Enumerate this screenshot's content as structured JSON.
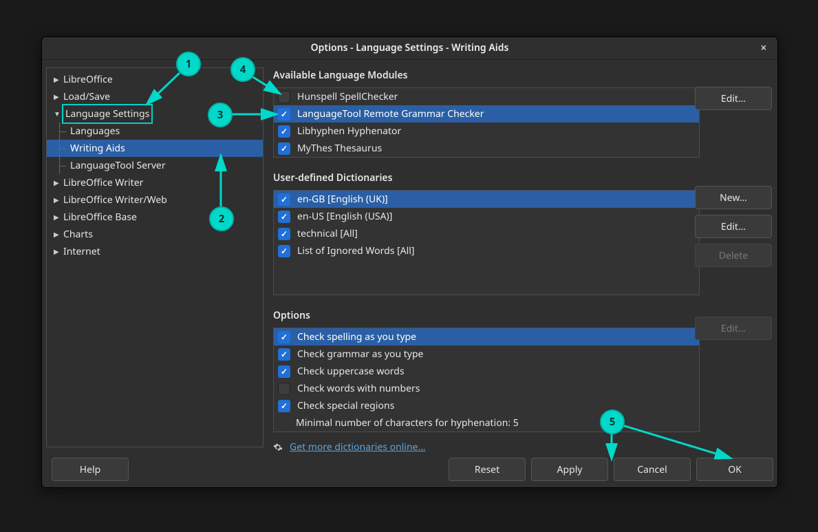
{
  "title": "Options - Language Settings - Writing Aids",
  "tree_top": [
    {
      "label": "LibreOffice",
      "arrow": "▶"
    },
    {
      "label": "Load/Save",
      "arrow": "▶"
    }
  ],
  "tree_lang_label": "Language Settings",
  "tree_lang_children": [
    {
      "label": "Languages"
    },
    {
      "label": "Writing Aids",
      "selected": true
    },
    {
      "label": "LanguageTool Server"
    }
  ],
  "tree_bottom": [
    {
      "label": "LibreOffice Writer",
      "arrow": "▶"
    },
    {
      "label": "LibreOffice Writer/Web",
      "arrow": "▶"
    },
    {
      "label": "LibreOffice Base",
      "arrow": "▶"
    },
    {
      "label": "Charts",
      "arrow": "▶"
    },
    {
      "label": "Internet",
      "arrow": "▶"
    }
  ],
  "section_modules": {
    "title": "Available Language Modules",
    "items": [
      {
        "label": "Hunspell SpellChecker",
        "checked": false
      },
      {
        "label": "LanguageTool Remote Grammar Checker",
        "checked": true,
        "selected": true
      },
      {
        "label": "Libhyphen Hyphenator",
        "checked": true
      },
      {
        "label": "MyThes Thesaurus",
        "checked": true
      }
    ],
    "edit_label": "Edit…"
  },
  "section_dicts": {
    "title": "User-defined Dictionaries",
    "items": [
      {
        "label": "en-GB [English (UK)]",
        "checked": true,
        "selected": true
      },
      {
        "label": "en-US [English (USA)]",
        "checked": true
      },
      {
        "label": "technical [All]",
        "checked": true
      },
      {
        "label": "List of Ignored Words [All]",
        "checked": true
      }
    ],
    "new_label": "New…",
    "edit_label": "Edit…",
    "delete_label": "Delete"
  },
  "section_options": {
    "title": "Options",
    "items": [
      {
        "label": "Check spelling as you type",
        "checked": true,
        "selected": true
      },
      {
        "label": "Check grammar as you type",
        "checked": true
      },
      {
        "label": "Check uppercase words",
        "checked": true
      },
      {
        "label": "Check words with numbers",
        "checked": false
      },
      {
        "label": "Check special regions",
        "checked": true
      }
    ],
    "extra_row": "Minimal number of characters for hyphenation:  5",
    "edit_label": "Edit…"
  },
  "more_dicts_link": "Get more dictionaries online…",
  "footer": {
    "help": "Help",
    "reset": "Reset",
    "apply": "Apply",
    "cancel": "Cancel",
    "ok": "OK"
  },
  "callouts": {
    "c1": "1",
    "c2": "2",
    "c3": "3",
    "c4": "4",
    "c5": "5"
  }
}
